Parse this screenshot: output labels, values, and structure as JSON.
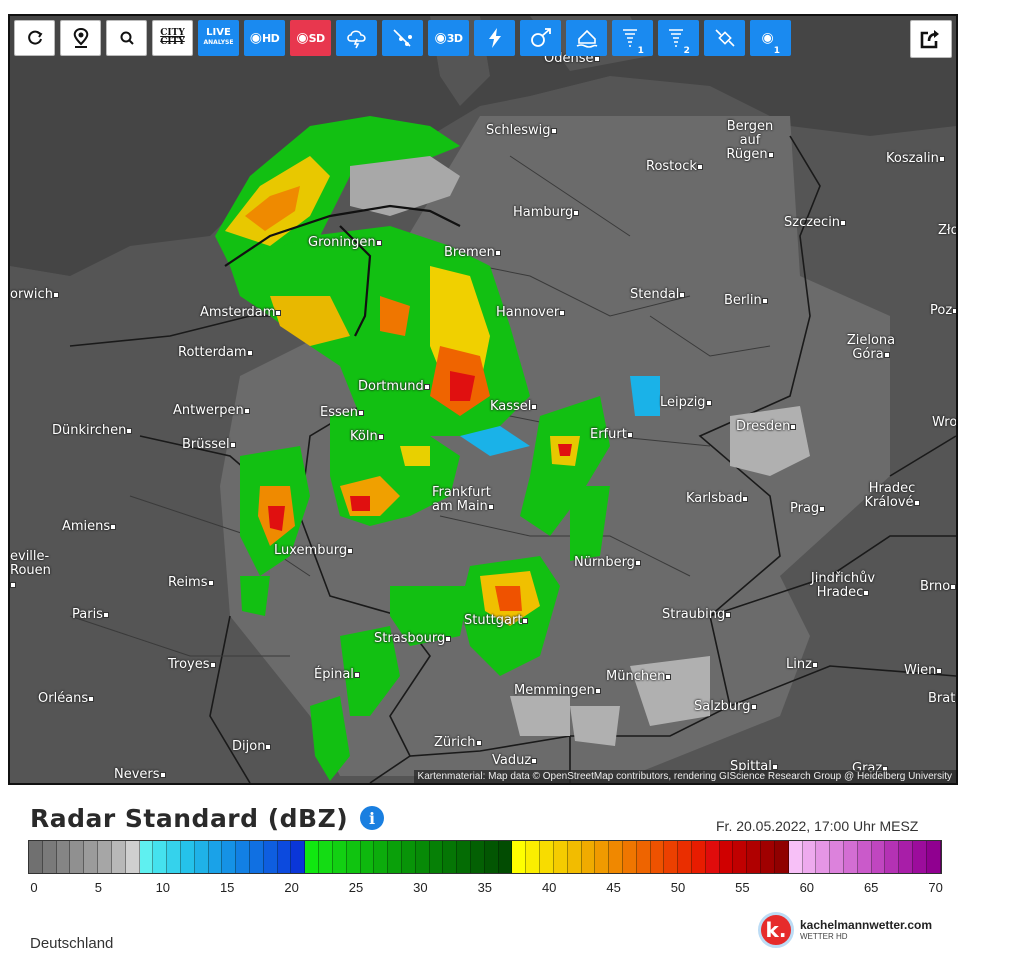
{
  "toolbar": {
    "buttons": [
      {
        "name": "refresh-icon",
        "label": ""
      },
      {
        "name": "location-pin-icon",
        "label": ""
      },
      {
        "name": "zoom-icon",
        "label": ""
      },
      {
        "name": "city-toggle",
        "label": "CITY"
      },
      {
        "name": "live-analyse",
        "label": "LIVE",
        "sub": "ANALYSE"
      },
      {
        "name": "radar-hd",
        "label": "HD"
      },
      {
        "name": "radar-sd",
        "label": "SD"
      },
      {
        "name": "cloud-lightning-icon",
        "label": ""
      },
      {
        "name": "hail-tracks-icon",
        "label": ""
      },
      {
        "name": "radar-3d",
        "label": "3D"
      },
      {
        "name": "lightning-icon",
        "label": ""
      },
      {
        "name": "storm-cell-icon",
        "label": ""
      },
      {
        "name": "flood-icon",
        "label": ""
      },
      {
        "name": "tornado-1-icon",
        "label": "1"
      },
      {
        "name": "tornado-2-icon",
        "label": "2"
      },
      {
        "name": "satellite-icon",
        "label": ""
      },
      {
        "name": "rain-1-icon",
        "label": "1"
      }
    ],
    "share_icon": "share-icon"
  },
  "map": {
    "cities": [
      {
        "name": "Odense"
      },
      {
        "name": "Schleswig"
      },
      {
        "name": "Bergen auf Rügen"
      },
      {
        "name": "Rostock"
      },
      {
        "name": "Koszalin"
      },
      {
        "name": "Hamburg"
      },
      {
        "name": "Szczecin"
      },
      {
        "name": "Zło"
      },
      {
        "name": "Groningen"
      },
      {
        "name": "Bremen"
      },
      {
        "name": "orwich"
      },
      {
        "name": "Stendal"
      },
      {
        "name": "Berlin"
      },
      {
        "name": "Poz"
      },
      {
        "name": "Amsterdam"
      },
      {
        "name": "Hannover"
      },
      {
        "name": "Zielona Góra"
      },
      {
        "name": "Rotterdam"
      },
      {
        "name": "Dortmund"
      },
      {
        "name": "Leipzig"
      },
      {
        "name": "Antwerpen"
      },
      {
        "name": "Essen"
      },
      {
        "name": "Kassel"
      },
      {
        "name": "Wro"
      },
      {
        "name": "Dünkirchen"
      },
      {
        "name": "Brüssel"
      },
      {
        "name": "Köln"
      },
      {
        "name": "Erfurt"
      },
      {
        "name": "Dresden"
      },
      {
        "name": "Frankfurt am Main"
      },
      {
        "name": "Karlsbad"
      },
      {
        "name": "Hradec Králové"
      },
      {
        "name": "Amiens"
      },
      {
        "name": "Prag"
      },
      {
        "name": "Luxemburg"
      },
      {
        "name": "eville-Rouen"
      },
      {
        "name": "Nürnberg"
      },
      {
        "name": "Reims"
      },
      {
        "name": "Jindřichův Hradec"
      },
      {
        "name": "Brno"
      },
      {
        "name": "Paris"
      },
      {
        "name": "Straubing"
      },
      {
        "name": "Stuttgart"
      },
      {
        "name": "Strasbourg"
      },
      {
        "name": "Troyes"
      },
      {
        "name": "Linz"
      },
      {
        "name": "Wien"
      },
      {
        "name": "Épinal"
      },
      {
        "name": "München"
      },
      {
        "name": "Orléans"
      },
      {
        "name": "Memmingen"
      },
      {
        "name": "Salzburg"
      },
      {
        "name": "Brat"
      },
      {
        "name": "Dijon"
      },
      {
        "name": "Zürich"
      },
      {
        "name": "Vaduz"
      },
      {
        "name": "Spittal"
      },
      {
        "name": "Graz"
      },
      {
        "name": "Nevers"
      }
    ],
    "attribution": "Kartenmaterial: Map data © OpenStreetMap contributors, rendering GIScience Research Group @ Heidelberg University"
  },
  "legend": {
    "title": "Radar Standard (dBZ)",
    "info_icon": "info-icon",
    "timestamp": "Fr. 20.05.2022, 17:00 Uhr MESZ",
    "ticks": [
      "0",
      "5",
      "10",
      "15",
      "20",
      "25",
      "30",
      "35",
      "40",
      "45",
      "50",
      "55",
      "60",
      "65",
      "70"
    ],
    "colors": [
      "#707070",
      "#7a7a7a",
      "#858585",
      "#909090",
      "#9b9b9b",
      "#a6a6a6",
      "#b8b8b8",
      "#cfcfcf",
      "#5ff0f0",
      "#45e2ee",
      "#35d2ec",
      "#25c2ea",
      "#1fb2e8",
      "#1aa2e8",
      "#1592e6",
      "#1280e4",
      "#1070e2",
      "#0e5ee0",
      "#0c4ade",
      "#0a36d8",
      "#10e810",
      "#14dc14",
      "#12d012",
      "#10c410",
      "#0eb80e",
      "#0cac0c",
      "#0aa00a",
      "#089408",
      "#078a07",
      "#068006",
      "#057605",
      "#046c04",
      "#036003",
      "#025602",
      "#024c02",
      "#ffff00",
      "#fbee00",
      "#f8dc00",
      "#f5cc00",
      "#f2bc00",
      "#f0ab00",
      "#f09a00",
      "#f08800",
      "#ef7600",
      "#ee6400",
      "#ee5200",
      "#ec4000",
      "#ea2e00",
      "#e81c00",
      "#e00c0c",
      "#d00000",
      "#c00000",
      "#b00000",
      "#a00000",
      "#900000",
      "#f7c0f7",
      "#eeaaee",
      "#e596e5",
      "#dc82dc",
      "#d36ed3",
      "#ca5aca",
      "#c046c0",
      "#b432b4",
      "#a81ea8",
      "#9c0c9c",
      "#900090"
    ]
  },
  "footer": {
    "region": "Deutschland",
    "brand": "kachelmannwetter.com",
    "brand_sub": "WETTER HD",
    "brand_logo": "k."
  }
}
